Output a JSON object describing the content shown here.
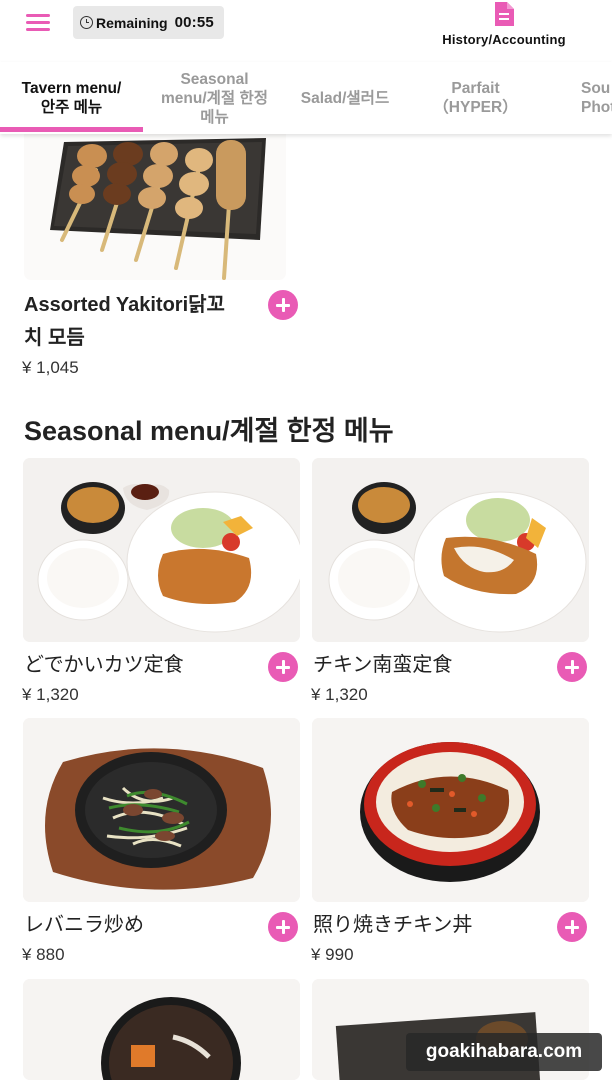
{
  "header": {
    "timer_label": "Remaining",
    "timer_value": "00:55",
    "history_label": "History/Accounting"
  },
  "tabs": [
    {
      "line1": "Tavern menu/",
      "line2": "안주 메뉴",
      "line3": "",
      "active": true
    },
    {
      "line1": "Seasonal",
      "line2": "menu/계절 한정",
      "line3": "메뉴",
      "active": false
    },
    {
      "line1": "Salad/샐러드",
      "line2": "",
      "line3": "",
      "active": false
    },
    {
      "line1": "Parfait",
      "line2": "（HYPER）",
      "line3": "",
      "active": false
    },
    {
      "line1": "Sou",
      "line2": "Phot",
      "line3": "",
      "active": false
    }
  ],
  "top_item": {
    "name_line1": "Assorted Yakitori닭꼬",
    "name_line2": "치 모듬",
    "price": "¥ 1,045"
  },
  "section": {
    "title": "Seasonal menu/계절 한정 메뉴"
  },
  "items": [
    {
      "name": "どでかいカツ定食",
      "price": "¥ 1,320"
    },
    {
      "name": "チキン南蛮定食",
      "price": "¥ 1,320"
    },
    {
      "name": "レバニラ炒め",
      "price": "¥ 880"
    },
    {
      "name": "照り焼きチキン丼",
      "price": "¥ 990"
    }
  ],
  "watermark": "goakihabara.com",
  "colors": {
    "accent": "#e95bb5",
    "timer_bg": "#e8e8e8",
    "inactive_tab": "#9a9a9a"
  },
  "icons": {
    "menu": "hamburger-menu-icon",
    "timer": "clock-icon",
    "history": "document-icon",
    "add": "plus-circle-icon"
  }
}
